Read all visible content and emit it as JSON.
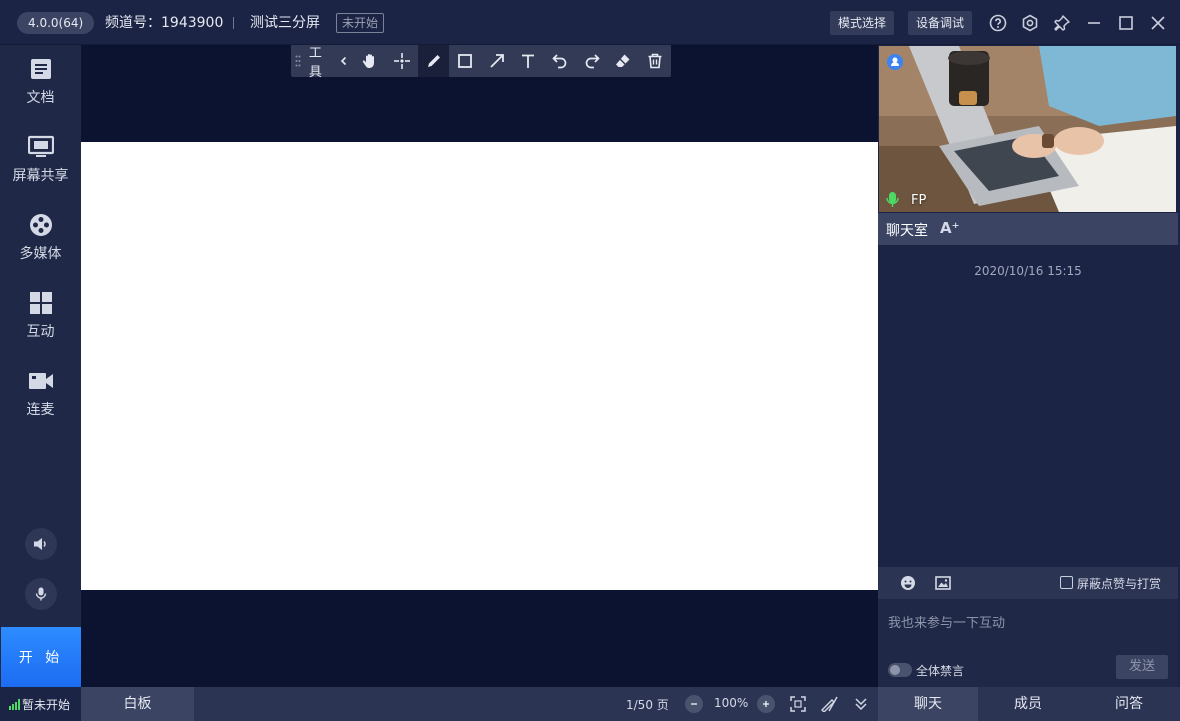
{
  "header": {
    "version": "4.0.0(64)",
    "channel_label": "频道号：1943900",
    "room_title": "测试三分屏",
    "status_tag": "未开始",
    "mode_button": "模式选择",
    "device_button": "设备调试"
  },
  "sidebar": {
    "items": [
      {
        "label": "文档",
        "icon": "document-icon"
      },
      {
        "label": "屏幕共享",
        "icon": "screen-share-icon"
      },
      {
        "label": "多媒体",
        "icon": "film-reel-icon"
      },
      {
        "label": "互动",
        "icon": "grid-icon"
      },
      {
        "label": "连麦",
        "icon": "video-camera-icon"
      }
    ],
    "start_button": "开 始"
  },
  "toolbar": {
    "label": "工具",
    "tools": [
      "hand-icon",
      "move-icon",
      "pen-icon",
      "rectangle-icon",
      "arrow-icon",
      "text-icon",
      "undo-icon",
      "redo-icon",
      "eraser-icon",
      "trash-icon"
    ],
    "active_tool": "pen-icon"
  },
  "video": {
    "name": "FP"
  },
  "chat": {
    "title": "聊天室",
    "font_toggle": "A⁺",
    "timestamp": "2020/10/16 15:15",
    "block_label": "屏蔽点赞与打赏",
    "input_placeholder": "我也来参与一下互动",
    "mute_label": "全体禁言",
    "send_button": "发送"
  },
  "bottombar": {
    "network_status": "暂未开始",
    "whiteboard_tab": "白板",
    "page_info": "1/50 页",
    "zoom": "100%",
    "right_tabs": [
      {
        "label": "聊天",
        "active": true
      },
      {
        "label": "成员",
        "active": false
      },
      {
        "label": "问答",
        "active": false
      }
    ]
  },
  "colors": {
    "background": "#1b2444",
    "stage": "#0b1330",
    "accent": "#1c6cf2",
    "mic_green": "#4cd964"
  }
}
